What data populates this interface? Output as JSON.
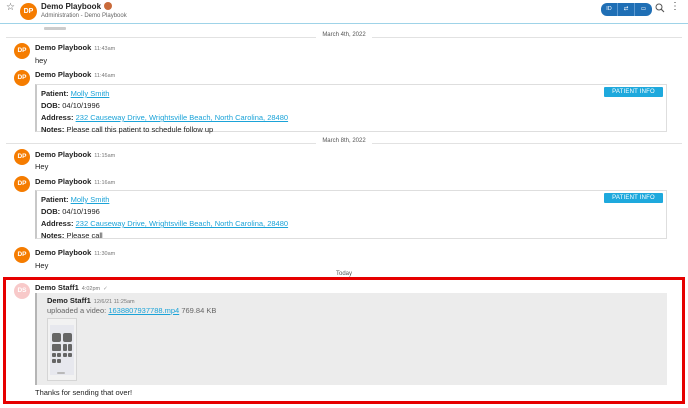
{
  "header": {
    "star_icon": "star-outline-icon",
    "avatar_initials": "DP",
    "title": "Demo Playbook",
    "subtitle": "Administration - Demo Playbook",
    "buttons": [
      {
        "icon": "id-card-icon",
        "label": "ID"
      },
      {
        "icon": "swap-icon",
        "label": "⇄"
      },
      {
        "icon": "video-icon",
        "label": "▭"
      }
    ],
    "search_icon": "search-icon",
    "menu_icon": "kebab-menu-icon"
  },
  "dividers": [
    "March 4th, 2022",
    "March 8th, 2022",
    "Today"
  ],
  "messages": [
    {
      "initials": "DP",
      "name": "Demo Playbook",
      "time": "11:43am",
      "text": "hey"
    },
    {
      "initials": "DP",
      "name": "Demo Playbook",
      "time": "11:46am",
      "card": {
        "patient_label": "Patient:",
        "patient": "Molly Smith",
        "dob_label": "DOB:",
        "dob": "04/10/1996",
        "address_label": "Address:",
        "address": "232 Causeway Drive, Wrightsville Beach, North Carolina, 28480",
        "notes_label": "Notes:",
        "notes": "Please call this patient to schedule follow up",
        "button": "PATIENT INFO"
      }
    },
    {
      "initials": "DP",
      "name": "Demo Playbook",
      "time": "11:15am",
      "text": "Hey"
    },
    {
      "initials": "DP",
      "name": "Demo Playbook",
      "time": "11:16am",
      "card": {
        "patient_label": "Patient:",
        "patient": "Molly Smith",
        "dob_label": "DOB:",
        "dob": "04/10/1996",
        "address_label": "Address:",
        "address": "232 Causeway Drive, Wrightsville Beach, North Carolina, 28480",
        "notes_label": "Notes:",
        "notes": "Please call",
        "button": "PATIENT INFO"
      }
    },
    {
      "initials": "DP",
      "name": "Demo Playbook",
      "time": "11:30am",
      "text": "Hey"
    },
    {
      "initials": "DS",
      "name": "Demo Staff1",
      "time": "4:02pm",
      "status": "✓",
      "quote": {
        "name": "Demo Staff1",
        "time": "12/6/21 11:25am",
        "prefix": "uploaded a video:",
        "file": "1638807937788.mp4",
        "size": "769.84 KB"
      },
      "text": "Thanks for sending that over!"
    }
  ],
  "colors": {
    "avatar": "#f57c00",
    "link": "#1ba3d8",
    "patient_info_button": "#1ea9dd",
    "header_buttons": "#1f6fb5",
    "highlight_border": "#e60000"
  }
}
